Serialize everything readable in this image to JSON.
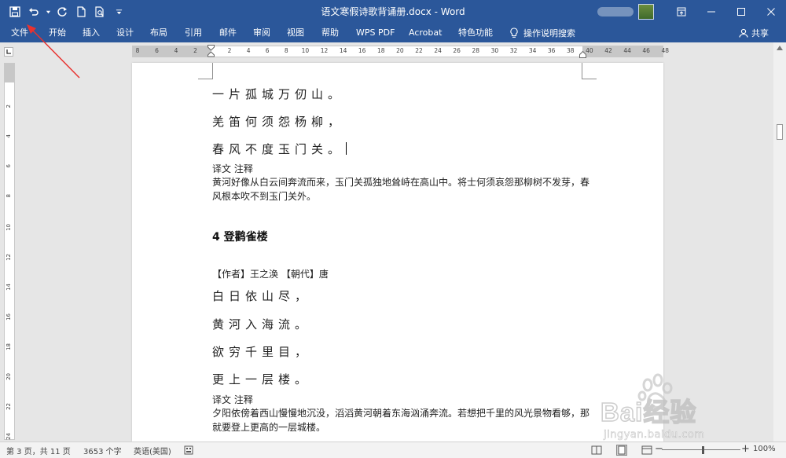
{
  "window": {
    "title": "语文寒假诗歌背诵册.docx - Word"
  },
  "ribbon": {
    "tabs": [
      "文件",
      "开始",
      "插入",
      "设计",
      "布局",
      "引用",
      "邮件",
      "审阅",
      "视图",
      "帮助",
      "WPS PDF",
      "Acrobat",
      "特色功能"
    ],
    "tell_me": "操作说明搜索",
    "share": "共享"
  },
  "ruler": {
    "h_ticks": [
      "8",
      "6",
      "4",
      "2",
      "2",
      "4",
      "6",
      "8",
      "10",
      "12",
      "14",
      "16",
      "18",
      "20",
      "22",
      "24",
      "26",
      "28",
      "30",
      "32",
      "34",
      "36",
      "38",
      "40",
      "42",
      "44",
      "46",
      "48"
    ],
    "v_ticks": [
      "2",
      "4",
      "6",
      "8",
      "10",
      "12",
      "14",
      "16",
      "18",
      "20",
      "22",
      "24"
    ]
  },
  "document": {
    "poem1_lines": [
      "一片孤城万仞山。",
      "羌笛何须怨杨柳，",
      "春风不度玉门关。"
    ],
    "note1_label": "译文 注释",
    "note1_text": "黄河好像从白云间奔流而来，玉门关孤独地耸峙在高山中。将士何须哀怨那柳树不发芽，春风根本吹不到玉门关外。",
    "heading2": "4 登鹳雀楼",
    "author_line": "【作者】王之涣 【朝代】唐",
    "poem2_lines": [
      "白日依山尽，",
      "黄河入海流。",
      "欲穷千里目，",
      "更上一层楼。"
    ],
    "note2_label": "译文 注释",
    "note2_text": "夕阳依傍着西山慢慢地沉没，滔滔黄河朝着东海汹涌奔流。若想把千里的风光景物看够，那就要登上更高的一层城楼。"
  },
  "status": {
    "page": "第 3 页，共 11 页",
    "words": "3653 个字",
    "language": "英语(美国)",
    "zoom": "100%"
  },
  "watermark": {
    "brand": "Bai经验",
    "url": "jingyan.baidu.com"
  },
  "colors": {
    "word_blue": "#2b579a",
    "arrow_red": "#e8322f"
  }
}
